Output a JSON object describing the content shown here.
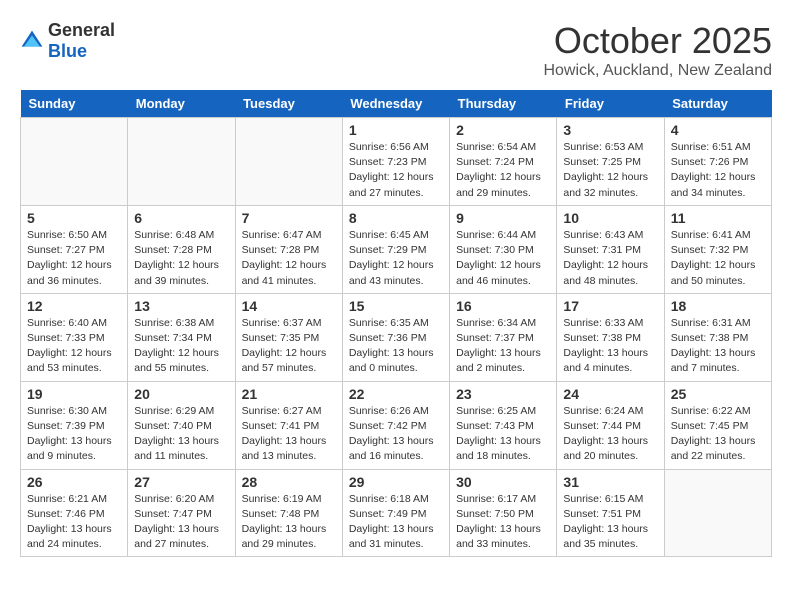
{
  "header": {
    "logo_general": "General",
    "logo_blue": "Blue",
    "month": "October 2025",
    "location": "Howick, Auckland, New Zealand"
  },
  "days_of_week": [
    "Sunday",
    "Monday",
    "Tuesday",
    "Wednesday",
    "Thursday",
    "Friday",
    "Saturday"
  ],
  "weeks": [
    [
      {
        "day": "",
        "info": ""
      },
      {
        "day": "",
        "info": ""
      },
      {
        "day": "",
        "info": ""
      },
      {
        "day": "1",
        "info": "Sunrise: 6:56 AM\nSunset: 7:23 PM\nDaylight: 12 hours\nand 27 minutes."
      },
      {
        "day": "2",
        "info": "Sunrise: 6:54 AM\nSunset: 7:24 PM\nDaylight: 12 hours\nand 29 minutes."
      },
      {
        "day": "3",
        "info": "Sunrise: 6:53 AM\nSunset: 7:25 PM\nDaylight: 12 hours\nand 32 minutes."
      },
      {
        "day": "4",
        "info": "Sunrise: 6:51 AM\nSunset: 7:26 PM\nDaylight: 12 hours\nand 34 minutes."
      }
    ],
    [
      {
        "day": "5",
        "info": "Sunrise: 6:50 AM\nSunset: 7:27 PM\nDaylight: 12 hours\nand 36 minutes."
      },
      {
        "day": "6",
        "info": "Sunrise: 6:48 AM\nSunset: 7:28 PM\nDaylight: 12 hours\nand 39 minutes."
      },
      {
        "day": "7",
        "info": "Sunrise: 6:47 AM\nSunset: 7:28 PM\nDaylight: 12 hours\nand 41 minutes."
      },
      {
        "day": "8",
        "info": "Sunrise: 6:45 AM\nSunset: 7:29 PM\nDaylight: 12 hours\nand 43 minutes."
      },
      {
        "day": "9",
        "info": "Sunrise: 6:44 AM\nSunset: 7:30 PM\nDaylight: 12 hours\nand 46 minutes."
      },
      {
        "day": "10",
        "info": "Sunrise: 6:43 AM\nSunset: 7:31 PM\nDaylight: 12 hours\nand 48 minutes."
      },
      {
        "day": "11",
        "info": "Sunrise: 6:41 AM\nSunset: 7:32 PM\nDaylight: 12 hours\nand 50 minutes."
      }
    ],
    [
      {
        "day": "12",
        "info": "Sunrise: 6:40 AM\nSunset: 7:33 PM\nDaylight: 12 hours\nand 53 minutes."
      },
      {
        "day": "13",
        "info": "Sunrise: 6:38 AM\nSunset: 7:34 PM\nDaylight: 12 hours\nand 55 minutes."
      },
      {
        "day": "14",
        "info": "Sunrise: 6:37 AM\nSunset: 7:35 PM\nDaylight: 12 hours\nand 57 minutes."
      },
      {
        "day": "15",
        "info": "Sunrise: 6:35 AM\nSunset: 7:36 PM\nDaylight: 13 hours\nand 0 minutes."
      },
      {
        "day": "16",
        "info": "Sunrise: 6:34 AM\nSunset: 7:37 PM\nDaylight: 13 hours\nand 2 minutes."
      },
      {
        "day": "17",
        "info": "Sunrise: 6:33 AM\nSunset: 7:38 PM\nDaylight: 13 hours\nand 4 minutes."
      },
      {
        "day": "18",
        "info": "Sunrise: 6:31 AM\nSunset: 7:38 PM\nDaylight: 13 hours\nand 7 minutes."
      }
    ],
    [
      {
        "day": "19",
        "info": "Sunrise: 6:30 AM\nSunset: 7:39 PM\nDaylight: 13 hours\nand 9 minutes."
      },
      {
        "day": "20",
        "info": "Sunrise: 6:29 AM\nSunset: 7:40 PM\nDaylight: 13 hours\nand 11 minutes."
      },
      {
        "day": "21",
        "info": "Sunrise: 6:27 AM\nSunset: 7:41 PM\nDaylight: 13 hours\nand 13 minutes."
      },
      {
        "day": "22",
        "info": "Sunrise: 6:26 AM\nSunset: 7:42 PM\nDaylight: 13 hours\nand 16 minutes."
      },
      {
        "day": "23",
        "info": "Sunrise: 6:25 AM\nSunset: 7:43 PM\nDaylight: 13 hours\nand 18 minutes."
      },
      {
        "day": "24",
        "info": "Sunrise: 6:24 AM\nSunset: 7:44 PM\nDaylight: 13 hours\nand 20 minutes."
      },
      {
        "day": "25",
        "info": "Sunrise: 6:22 AM\nSunset: 7:45 PM\nDaylight: 13 hours\nand 22 minutes."
      }
    ],
    [
      {
        "day": "26",
        "info": "Sunrise: 6:21 AM\nSunset: 7:46 PM\nDaylight: 13 hours\nand 24 minutes."
      },
      {
        "day": "27",
        "info": "Sunrise: 6:20 AM\nSunset: 7:47 PM\nDaylight: 13 hours\nand 27 minutes."
      },
      {
        "day": "28",
        "info": "Sunrise: 6:19 AM\nSunset: 7:48 PM\nDaylight: 13 hours\nand 29 minutes."
      },
      {
        "day": "29",
        "info": "Sunrise: 6:18 AM\nSunset: 7:49 PM\nDaylight: 13 hours\nand 31 minutes."
      },
      {
        "day": "30",
        "info": "Sunrise: 6:17 AM\nSunset: 7:50 PM\nDaylight: 13 hours\nand 33 minutes."
      },
      {
        "day": "31",
        "info": "Sunrise: 6:15 AM\nSunset: 7:51 PM\nDaylight: 13 hours\nand 35 minutes."
      },
      {
        "day": "",
        "info": ""
      }
    ]
  ]
}
